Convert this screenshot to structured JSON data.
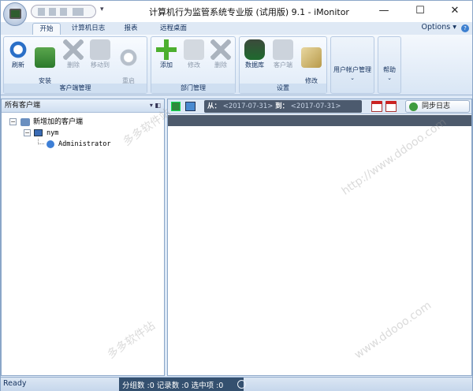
{
  "titlebar": {
    "title": "计算机行为监管系统专业版 (试用版) 9.1 - iMonitor",
    "qat_dropdown": "▾",
    "min": "—",
    "max": "☐",
    "close": "✕"
  },
  "tabs": [
    {
      "label": "开始"
    },
    {
      "label": "计算机日志"
    },
    {
      "label": "报表"
    },
    {
      "label": "远程桌面"
    }
  ],
  "options": {
    "label": "Options ▾",
    "help": "?"
  },
  "ribbon": {
    "client_group": {
      "label": "客户端管理",
      "buttons": [
        {
          "label": "刷新"
        },
        {
          "label": "安装\n客户端"
        },
        {
          "label": "删除"
        },
        {
          "label": "移动到"
        },
        {
          "label": "重启\n客户端"
        }
      ]
    },
    "dept_group": {
      "label": "部门管理",
      "buttons": [
        {
          "label": "添加"
        },
        {
          "label": "修改"
        },
        {
          "label": "删除"
        }
      ]
    },
    "settings_group": {
      "label": "设置",
      "buttons": [
        {
          "label": "数据库"
        },
        {
          "label": "客户端"
        },
        {
          "label": "修改\n语言"
        }
      ]
    },
    "user_account": {
      "label": "用户帐户管理",
      "dd": "⌄"
    },
    "help": {
      "label": "帮助",
      "dd": "⌄"
    }
  },
  "left_panel": {
    "header": "所有客户端",
    "pin": "▾ ◧",
    "tree": [
      {
        "label": "新增加的客户端",
        "toggle": "−"
      },
      {
        "label": "nym",
        "toggle": "−"
      },
      {
        "label": "Administrator"
      }
    ]
  },
  "right_panel": {
    "date_from_label": "从：",
    "date_from": "<2017-07-31>",
    "date_to_label": "到：",
    "date_to": "<2017-07-31>",
    "sync_label": "同步日志"
  },
  "statusbar": {
    "ready": "Ready",
    "counts": "分组数 :0  记录数 :0  选中项 :0"
  },
  "watermarks": [
    "多多软件站",
    "http://www.ddooo.com",
    "多多软件站",
    "www.ddooo.com"
  ]
}
